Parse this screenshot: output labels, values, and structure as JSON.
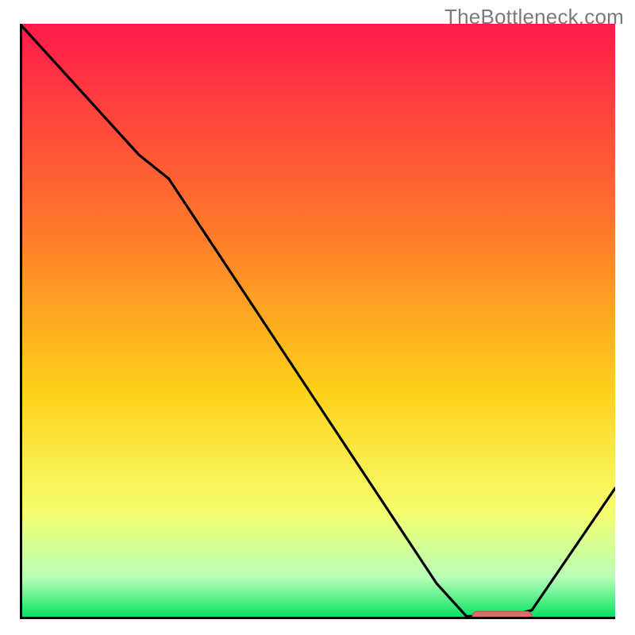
{
  "watermark": "TheBottleneck.com",
  "colors": {
    "gradient_top": "#ff1a4b",
    "gradient_mid1": "#ff7a2a",
    "gradient_mid2": "#ffd21a",
    "gradient_mid3": "#f6ff6e",
    "gradient_bottom_band": "#b8ffb8",
    "gradient_bottom": "#00e060",
    "axis": "#000000",
    "curve": "#000000",
    "marker_fill": "#e06a6a",
    "marker_stroke": "#c24e4e"
  },
  "chart_data": {
    "type": "line",
    "title": "",
    "xlabel": "",
    "ylabel": "",
    "xlim": [
      0,
      100
    ],
    "ylim": [
      0,
      100
    ],
    "grid": false,
    "legend": false,
    "series": [
      {
        "name": "curve",
        "x": [
          0,
          20,
          25,
          70,
          75,
          82,
          86,
          100
        ],
        "y": [
          100,
          78,
          74,
          6,
          0.5,
          0.5,
          1.5,
          22
        ]
      }
    ],
    "marker": {
      "name": "optimal-point",
      "x_start": 76,
      "x_end": 86,
      "y": 0.5
    },
    "notes": "Gradient background runs red→orange→yellow→pale-yellow→pale-green→green top to bottom. Values estimated from pixel positions; no axis ticks or numeric labels shown."
  }
}
